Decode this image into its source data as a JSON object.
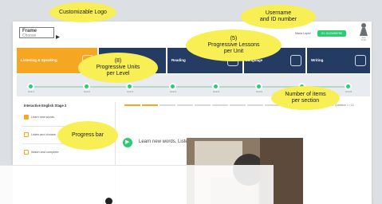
{
  "header": {
    "logo_line1": "Frame",
    "logo_line2": "Choose",
    "username": "Maria Lopez",
    "id_badge": "ID: 0123456789",
    "avatar_caption": "Jane Smith"
  },
  "lessons": [
    {
      "title": "Listening & Speaking",
      "color": "#f5a623"
    },
    {
      "title": "",
      "color": "#243b63"
    },
    {
      "title": "Reading",
      "color": "#253c65"
    },
    {
      "title": "Language",
      "color": "#243b63"
    },
    {
      "title": "Writing",
      "color": "#243b63"
    }
  ],
  "units": [
    "Unit 1",
    "Unit 2",
    "Unit 3",
    "Unit 4",
    "Unit 5",
    "Unit 6",
    "Unit 7",
    "Unit 8"
  ],
  "sidebar": {
    "title": "Interactive English Stage 2",
    "items": [
      "Learn new words.",
      "Listen and choose.",
      "Watch and complete."
    ]
  },
  "progress": {
    "segments_total": 12,
    "segments_done": 2,
    "question_counter": "Question 1 / 12"
  },
  "content": {
    "instruction": "Learn new words. Listen and Say."
  },
  "callouts": {
    "logo": "Customizable Logo",
    "user": "Username\nand ID number",
    "lessons": "(5)\nProgressive Lessons\nper Unit",
    "units": "(8)\nProgressive Units\nper Level",
    "items": "Number of items\nper section",
    "progress": "Progress bar"
  },
  "colors": {
    "accent_orange": "#f5a623",
    "navy": "#243b63",
    "green": "#2ecc71",
    "callout_yellow": "#f8ef55"
  }
}
